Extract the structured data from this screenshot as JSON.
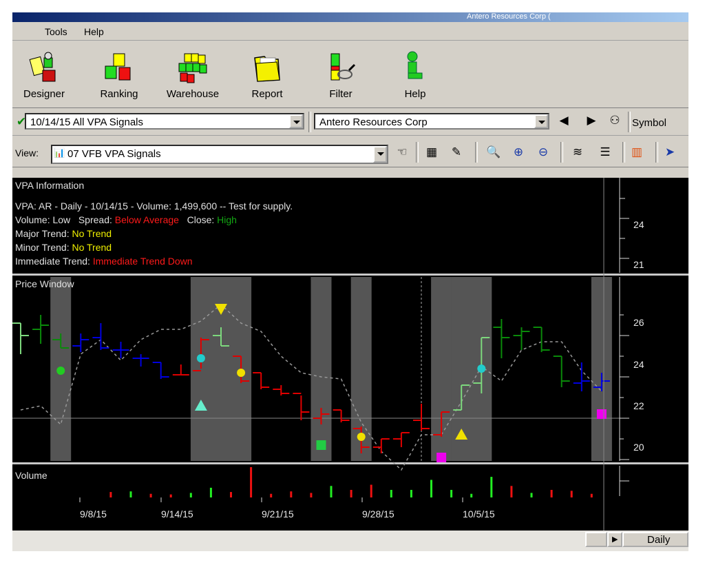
{
  "window": {
    "title_fragment": "Antero Resources Corp ("
  },
  "menu": [
    {
      "label": "Tools"
    },
    {
      "label": "Help"
    }
  ],
  "big_toolbar": [
    {
      "label": "Designer",
      "icon": "designer-icon"
    },
    {
      "label": "Ranking",
      "icon": "ranking-icon"
    },
    {
      "label": "Warehouse",
      "icon": "warehouse-icon"
    },
    {
      "label": "Report",
      "icon": "report-folder-icon"
    },
    {
      "label": "Filter",
      "icon": "filter-icon"
    },
    {
      "label": "Help",
      "icon": "help-info-icon"
    }
  ],
  "selectors": {
    "watchlist_value": "10/14/15 All VPA Signals",
    "symbol_value": "Antero Resources Corp",
    "symbol_label": "Symbol",
    "view_label": "View:",
    "view_value": "07 VFB VPA Signals"
  },
  "colors": {
    "up_green": "#0a8a0a",
    "light_green": "#7dd87d",
    "down_red": "#e00000",
    "neutral_blue": "#0000e0",
    "shade": "#555555"
  },
  "vpa_info": {
    "title": "VPA Information",
    "line1": "VPA: AR - Daily - 10/14/15 - Volume: 1,499,600 -- Test for supply.",
    "volume_label": "Volume:",
    "volume_value": "Low",
    "spread_label": "Spread:",
    "spread_value": "Below Average",
    "close_label": "Close:",
    "close_value": "High",
    "major_label": "Major Trend:",
    "major_value": "No Trend",
    "minor_label": "Minor Trend:",
    "minor_value": "No Trend",
    "immediate_label": "Immediate Trend:",
    "immediate_value": "Immediate Trend Down",
    "axis_ticks": [
      "24",
      "21"
    ]
  },
  "price_window": {
    "title": "Price Window",
    "axis_ticks": [
      "26",
      "24",
      "22",
      "20"
    ]
  },
  "volume_window": {
    "title": "Volume",
    "date_labels": [
      "9/8/15",
      "9/14/15",
      "9/21/15",
      "9/28/15",
      "10/5/15"
    ]
  },
  "status": {
    "timeframe": "Daily"
  },
  "chart_data": {
    "type": "ohlc",
    "title": "Price Window",
    "ylim": [
      19.5,
      27.5
    ],
    "y_ticks": [
      20,
      22,
      24,
      26
    ],
    "x_tick_labels": [
      "9/8/15",
      "9/14/15",
      "9/21/15",
      "9/28/15",
      "10/5/15"
    ],
    "bars": [
      {
        "h": 26.6,
        "l": 25.1,
        "o": 26.6,
        "c": 26.0,
        "col": "lg"
      },
      {
        "h": 27.0,
        "l": 25.6,
        "o": 26.3,
        "c": 26.5,
        "col": "g"
      },
      {
        "h": 26.1,
        "l": 25.4,
        "o": 25.8,
        "c": 25.4,
        "col": "g"
      },
      {
        "h": 26.1,
        "l": 25.2,
        "o": 25.5,
        "c": 25.8,
        "col": "b"
      },
      {
        "h": 26.6,
        "l": 25.3,
        "o": 25.9,
        "c": 25.4,
        "col": "b"
      },
      {
        "h": 25.7,
        "l": 24.9,
        "o": 25.3,
        "c": 25.3,
        "col": "b"
      },
      {
        "h": 25.1,
        "l": 24.5,
        "o": 24.9,
        "c": 24.9,
        "col": "b"
      },
      {
        "h": 24.7,
        "l": 23.9,
        "o": 24.7,
        "c": 24.0,
        "col": "b"
      },
      {
        "h": 24.6,
        "l": 24.1,
        "o": 24.1,
        "c": 24.1,
        "col": "r"
      },
      {
        "h": 25.9,
        "l": 24.4,
        "o": 24.3,
        "c": 25.8,
        "col": "r"
      },
      {
        "h": 26.4,
        "l": 25.5,
        "o": 26.0,
        "c": 25.5,
        "col": "lg"
      },
      {
        "h": 25.0,
        "l": 23.7,
        "o": 25.0,
        "c": 23.8,
        "col": "r"
      },
      {
        "h": 24.2,
        "l": 23.4,
        "o": 24.2,
        "c": 23.5,
        "col": "r"
      },
      {
        "h": 23.6,
        "l": 23.1,
        "o": 23.4,
        "c": 23.2,
        "col": "r"
      },
      {
        "h": 23.1,
        "l": 21.9,
        "o": 23.2,
        "c": 22.3,
        "col": "r"
      },
      {
        "h": 22.5,
        "l": 21.7,
        "o": 22.0,
        "c": 22.2,
        "col": "r"
      },
      {
        "h": 22.4,
        "l": 21.8,
        "o": 22.4,
        "c": 21.9,
        "col": "r"
      },
      {
        "h": 21.6,
        "l": 20.3,
        "o": 21.5,
        "c": 20.6,
        "col": "r"
      },
      {
        "h": 21.0,
        "l": 20.3,
        "o": 20.6,
        "c": 21.0,
        "col": "r"
      },
      {
        "h": 21.3,
        "l": 20.6,
        "o": 21.0,
        "c": 21.3,
        "col": "r"
      },
      {
        "h": 22.7,
        "l": 21.4,
        "o": 21.9,
        "c": 21.5,
        "col": "r"
      },
      {
        "h": 22.3,
        "l": 21.1,
        "o": 21.2,
        "c": 22.3,
        "col": "r"
      },
      {
        "h": 23.6,
        "l": 22.4,
        "o": 22.4,
        "c": 23.6,
        "col": "lg"
      },
      {
        "h": 25.9,
        "l": 23.2,
        "o": 23.7,
        "c": 25.9,
        "col": "lg"
      },
      {
        "h": 26.8,
        "l": 24.9,
        "o": 26.4,
        "c": 25.9,
        "col": "g"
      },
      {
        "h": 26.4,
        "l": 25.3,
        "o": 26.0,
        "c": 26.2,
        "col": "g"
      },
      {
        "h": 26.4,
        "l": 25.2,
        "o": 26.4,
        "c": 25.3,
        "col": "g"
      },
      {
        "h": 25.0,
        "l": 23.5,
        "o": 25.0,
        "c": 23.8,
        "col": "g"
      },
      {
        "h": 24.7,
        "l": 23.3,
        "o": 23.7,
        "c": 23.8,
        "col": "b"
      },
      {
        "h": 24.2,
        "l": 23.3,
        "o": 23.5,
        "c": 23.8,
        "col": "b"
      }
    ],
    "moving_average": [
      22.4,
      22.6,
      21.7,
      25.1,
      25.8,
      24.8,
      25.8,
      26.3,
      26.3,
      26.7,
      27.5,
      26.6,
      26.2,
      25.0,
      24.2,
      24.0,
      23.9,
      21.8,
      20.4,
      19.5,
      21.2,
      21.2,
      22.8,
      24.5,
      23.8,
      25.3,
      25.7,
      25.7,
      24.3,
      23.3
    ],
    "shaded_bars": [
      2,
      9,
      10,
      11,
      15,
      17,
      21,
      22,
      23,
      29
    ],
    "markers": [
      {
        "bar": 2,
        "price": 24.3,
        "shape": "dot",
        "color": "#22cc22"
      },
      {
        "bar": 9,
        "price": 24.9,
        "shape": "dot",
        "color": "#22cccc"
      },
      {
        "bar": 9,
        "price": 22.6,
        "shape": "triangle-up",
        "color": "#66eecc"
      },
      {
        "bar": 10,
        "price": 27.3,
        "shape": "triangle-down",
        "color": "#f0e000"
      },
      {
        "bar": 11,
        "price": 24.2,
        "shape": "dot",
        "color": "#f0e000"
      },
      {
        "bar": 15,
        "price": 20.7,
        "shape": "square",
        "color": "#22cc44"
      },
      {
        "bar": 17,
        "price": 21.1,
        "shape": "dot",
        "color": "#f0e000"
      },
      {
        "bar": 21,
        "price": 20.1,
        "shape": "square",
        "color": "#ee00ee"
      },
      {
        "bar": 22,
        "price": 21.2,
        "shape": "triangle-up",
        "color": "#f0e000"
      },
      {
        "bar": 23,
        "price": 24.4,
        "shape": "dot",
        "color": "#22cccc"
      },
      {
        "bar": 29,
        "price": 22.2,
        "shape": "square",
        "color": "#ee00ee"
      }
    ],
    "volume": [
      {
        "v": 0,
        "col": "g"
      },
      {
        "v": 0,
        "col": "g"
      },
      {
        "v": 0,
        "col": "g"
      },
      {
        "v": 0,
        "col": "g"
      },
      {
        "v": 0.18,
        "col": "r"
      },
      {
        "v": 0.2,
        "col": "g"
      },
      {
        "v": 0.12,
        "col": "r"
      },
      {
        "v": 0.1,
        "col": "r"
      },
      {
        "v": 0.15,
        "col": "g"
      },
      {
        "v": 0.32,
        "col": "g"
      },
      {
        "v": 0.18,
        "col": "r"
      },
      {
        "v": 1.0,
        "col": "r"
      },
      {
        "v": 0.12,
        "col": "r"
      },
      {
        "v": 0.2,
        "col": "r"
      },
      {
        "v": 0.15,
        "col": "r"
      },
      {
        "v": 0.38,
        "col": "g"
      },
      {
        "v": 0.25,
        "col": "r"
      },
      {
        "v": 0.42,
        "col": "r"
      },
      {
        "v": 0.25,
        "col": "g"
      },
      {
        "v": 0.25,
        "col": "g"
      },
      {
        "v": 0.58,
        "col": "g"
      },
      {
        "v": 0.25,
        "col": "g"
      },
      {
        "v": 0.12,
        "col": "g"
      },
      {
        "v": 0.68,
        "col": "g"
      },
      {
        "v": 0.38,
        "col": "r"
      },
      {
        "v": 0.15,
        "col": "g"
      },
      {
        "v": 0.25,
        "col": "r"
      },
      {
        "v": 0.22,
        "col": "r"
      },
      {
        "v": 0.12,
        "col": "r"
      },
      {
        "v": 0,
        "col": "g"
      }
    ]
  }
}
